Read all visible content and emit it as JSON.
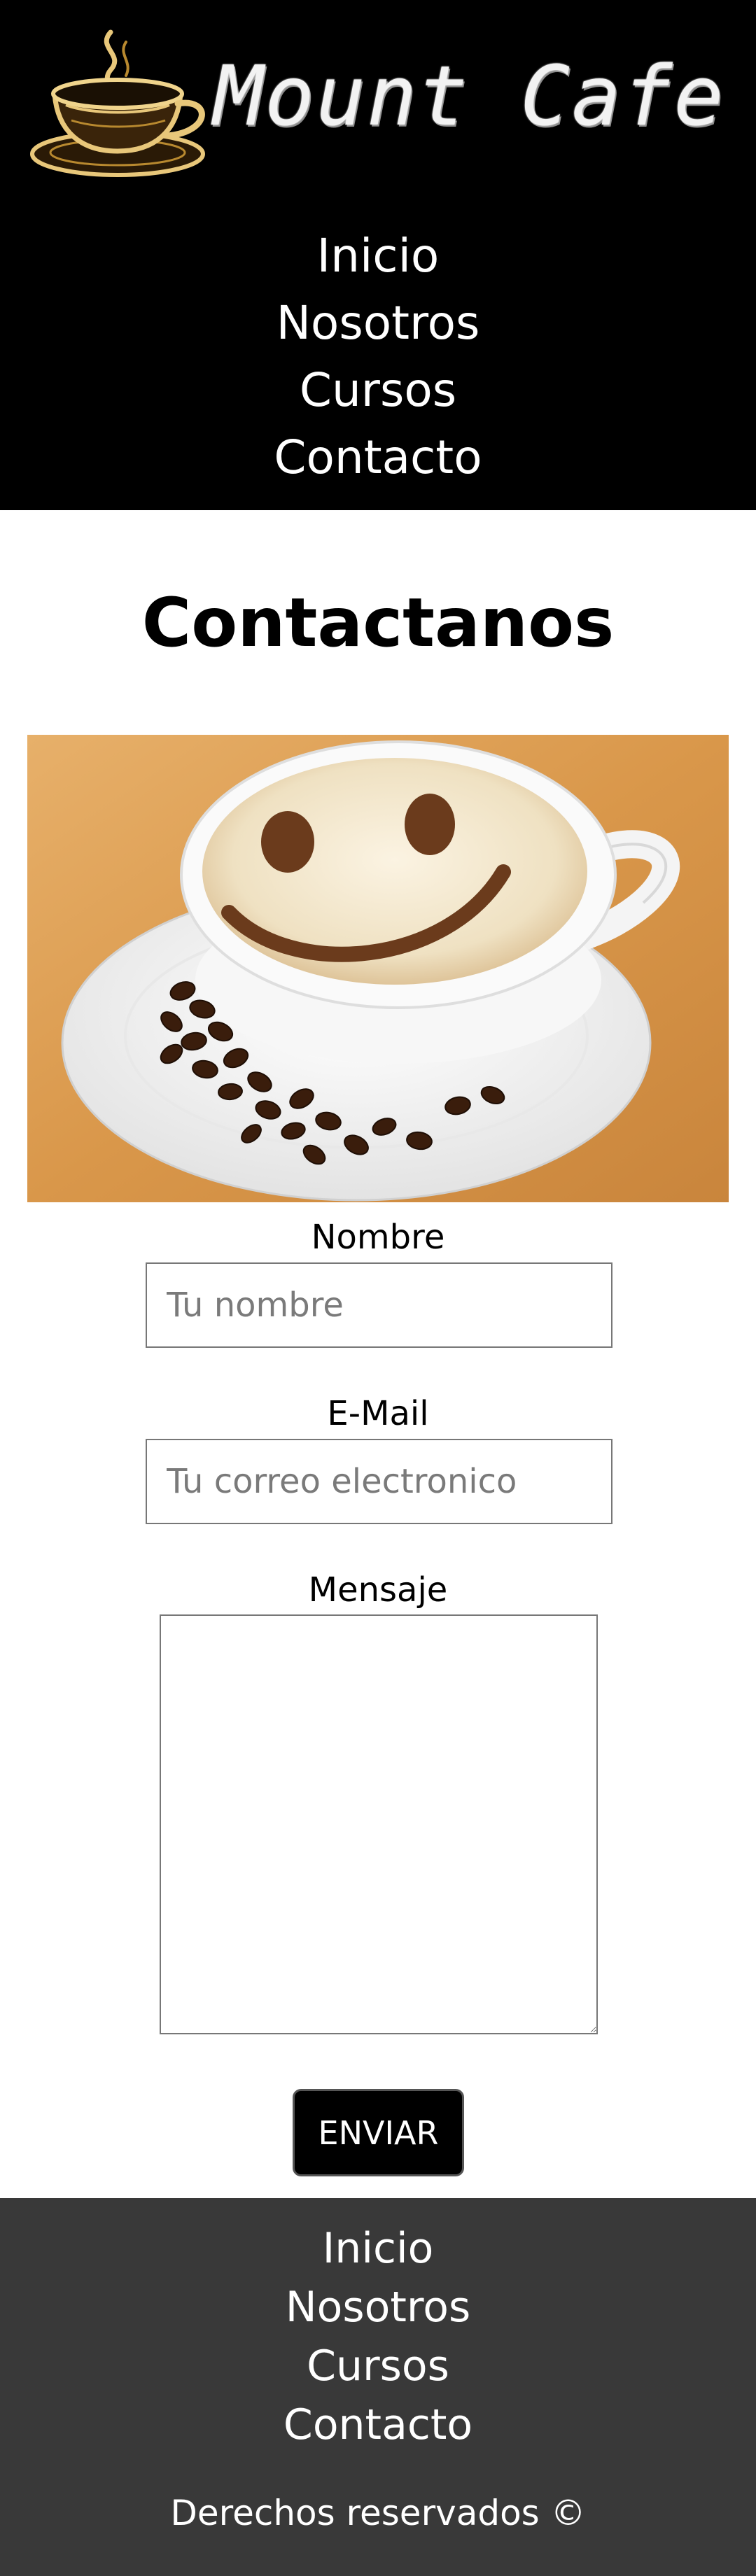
{
  "header": {
    "logo_text": "Mount Cafe",
    "nav": [
      "Inicio",
      "Nosotros",
      "Cursos",
      "Contacto"
    ]
  },
  "main": {
    "title": "Contactanos",
    "form": {
      "name_label": "Nombre",
      "name_placeholder": "Tu nombre",
      "email_label": "E-Mail",
      "email_placeholder": "Tu correo electronico",
      "message_label": "Mensaje",
      "submit_label": "ENVIAR"
    }
  },
  "footer": {
    "nav": [
      "Inicio",
      "Nosotros",
      "Cursos",
      "Contacto"
    ],
    "copyright": "Derechos reservados ©"
  },
  "colors": {
    "header_bg": "#000000",
    "footer_bg": "#393939",
    "button_bg": "#000000",
    "logo_cup": "#e8c77a"
  }
}
